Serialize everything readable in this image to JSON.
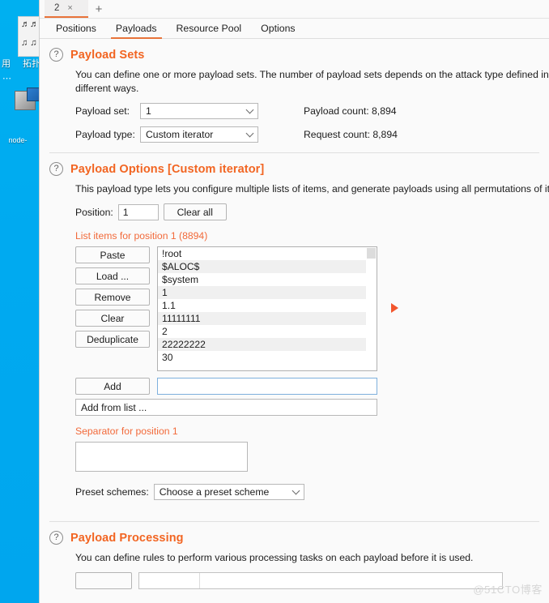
{
  "desktop": {
    "icons": [
      {
        "label": "拓扑",
        "name": "topology-icon"
      },
      {
        "label": "node-",
        "name": "node-icon"
      },
      {
        "label": "用",
        "name": "partial-icon"
      }
    ]
  },
  "window": {
    "tab": {
      "label": "2",
      "close": "×"
    },
    "new_tab": "+"
  },
  "nav": {
    "tabs": [
      {
        "label": "Positions",
        "active": false
      },
      {
        "label": "Payloads",
        "active": true
      },
      {
        "label": "Resource Pool",
        "active": false
      },
      {
        "label": "Options",
        "active": false
      }
    ]
  },
  "payload_sets": {
    "help_icon": "?",
    "title": "Payload Sets",
    "description": "You can define one or more payload sets. The number of payload sets depends on the attack type defined in the\ndifferent ways.",
    "payload_set_label": "Payload set:",
    "payload_set_value": "1",
    "payload_type_label": "Payload type:",
    "payload_type_value": "Custom iterator",
    "payload_count_label": "Payload count:",
    "payload_count_value": "8,894",
    "request_count_label": "Request count:",
    "request_count_value": "8,894"
  },
  "payload_options": {
    "help_icon": "?",
    "title": "Payload Options [Custom iterator]",
    "description": "This payload type lets you configure multiple lists of items, and generate payloads using all permutations of item",
    "position_label": "Position:",
    "position_value": "1",
    "clear_all_label": "Clear all",
    "list_header": "List items for position 1 (8894)",
    "buttons": [
      "Paste",
      "Load ...",
      "Remove",
      "Clear",
      "Deduplicate"
    ],
    "list_items": [
      "!root",
      "$ALOC$",
      "$system",
      "1",
      "1.1",
      "11111111",
      "2",
      "22222222",
      "30"
    ],
    "add_label": "Add",
    "add_value": "",
    "add_from_list_label": "Add from list ...",
    "separator_label": "Separator for position 1",
    "separator_value": "",
    "preset_label": "Preset schemes:",
    "preset_value": "Choose a preset scheme"
  },
  "payload_processing": {
    "help_icon": "?",
    "title": "Payload Processing",
    "description": "You can define rules to perform various processing tasks on each payload before it is used."
  },
  "watermark": "@51CTO博客",
  "colors": {
    "accent": "#f26522",
    "accent_soft": "#f26a3a",
    "desktop": "#00aaf0",
    "marker": "#f2552c"
  }
}
